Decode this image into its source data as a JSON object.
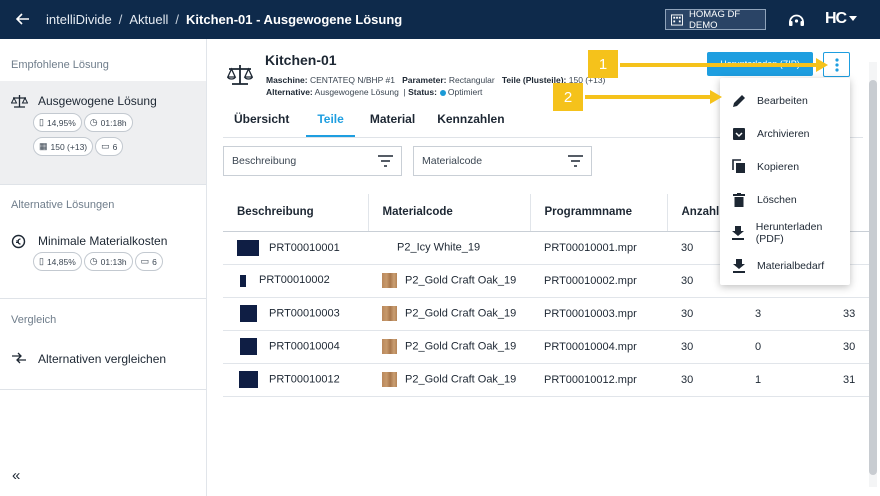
{
  "topbar": {
    "app_name": "intelliDivide",
    "crumb_current": "Aktuell",
    "page_title": "Kitchen-01 - Ausgewogene Lösung",
    "tenant": "HOMAG DF DEMO",
    "separator": "/",
    "brand_logo": "HC"
  },
  "sidebar": {
    "section_recommended": "Empfohlene Lösung",
    "recommended_title": "Ausgewogene Lösung",
    "recommended_chips": {
      "waste": "14,95%",
      "time": "01:18h",
      "stacks": "150 (+13)",
      "machines": "6"
    },
    "section_alternatives": "Alternative Lösungen",
    "alt_title": "Minimale Materialkosten",
    "alt_chips": {
      "waste": "14,85%",
      "time": "01:13h",
      "machines": "6"
    },
    "section_compare": "Vergleich",
    "compare_label": "Alternativen vergleichen",
    "collapse_glyph": "«"
  },
  "header": {
    "title": "Kitchen-01",
    "machine_label": "Maschine:",
    "machine_value": "CENTATEQ N/BHP #1",
    "param_label": "Parameter:",
    "param_value": "Rectangular",
    "parts_label": "Teile (Plusteile):",
    "parts_value": "150 (+13)",
    "alt_label": "Alternative:",
    "alt_value": "Ausgewogene Lösung",
    "status_label": "Status:",
    "status_value": "Optimiert",
    "primary_button": "Herunterladen (ZIP)"
  },
  "tabs": [
    "Übersicht",
    "Teile",
    "Material",
    "Kennzahlen"
  ],
  "filters": {
    "description_placeholder": "Beschreibung",
    "material_placeholder": "Materialcode"
  },
  "table": {
    "columns": [
      "Beschreibung",
      "Materialcode",
      "Programmname",
      "Anzahl"
    ],
    "rows": [
      {
        "desc": "PRT00010001",
        "material": "P2_Icy White_19",
        "program": "PRT00010001.mpr",
        "qty": "30",
        "extra": "",
        "extra2": "",
        "swatch": "white"
      },
      {
        "desc": "PRT00010002",
        "material": "P2_Gold Craft Oak_19",
        "program": "PRT00010002.mpr",
        "qty": "30",
        "extra": "",
        "extra2": "",
        "swatch": "wood"
      },
      {
        "desc": "PRT00010003",
        "material": "P2_Gold Craft Oak_19",
        "program": "PRT00010003.mpr",
        "qty": "30",
        "extra": "3",
        "extra2": "33",
        "swatch": "wood"
      },
      {
        "desc": "PRT00010004",
        "material": "P2_Gold Craft Oak_19",
        "program": "PRT00010004.mpr",
        "qty": "30",
        "extra": "0",
        "extra2": "30",
        "swatch": "wood"
      },
      {
        "desc": "PRT00010012",
        "material": "P2_Gold Craft Oak_19",
        "program": "PRT00010012.mpr",
        "qty": "30",
        "extra": "1",
        "extra2": "31",
        "swatch": "wood"
      }
    ]
  },
  "menu": {
    "items": [
      "Bearbeiten",
      "Archivieren",
      "Kopieren",
      "Löschen",
      "Herunterladen (PDF)",
      "Materialbedarf"
    ]
  },
  "callouts": [
    "1",
    "2"
  ],
  "colors": {
    "topbar": "#0e2a4b",
    "accent": "#1e9ee0",
    "callout": "#f5c21b"
  }
}
